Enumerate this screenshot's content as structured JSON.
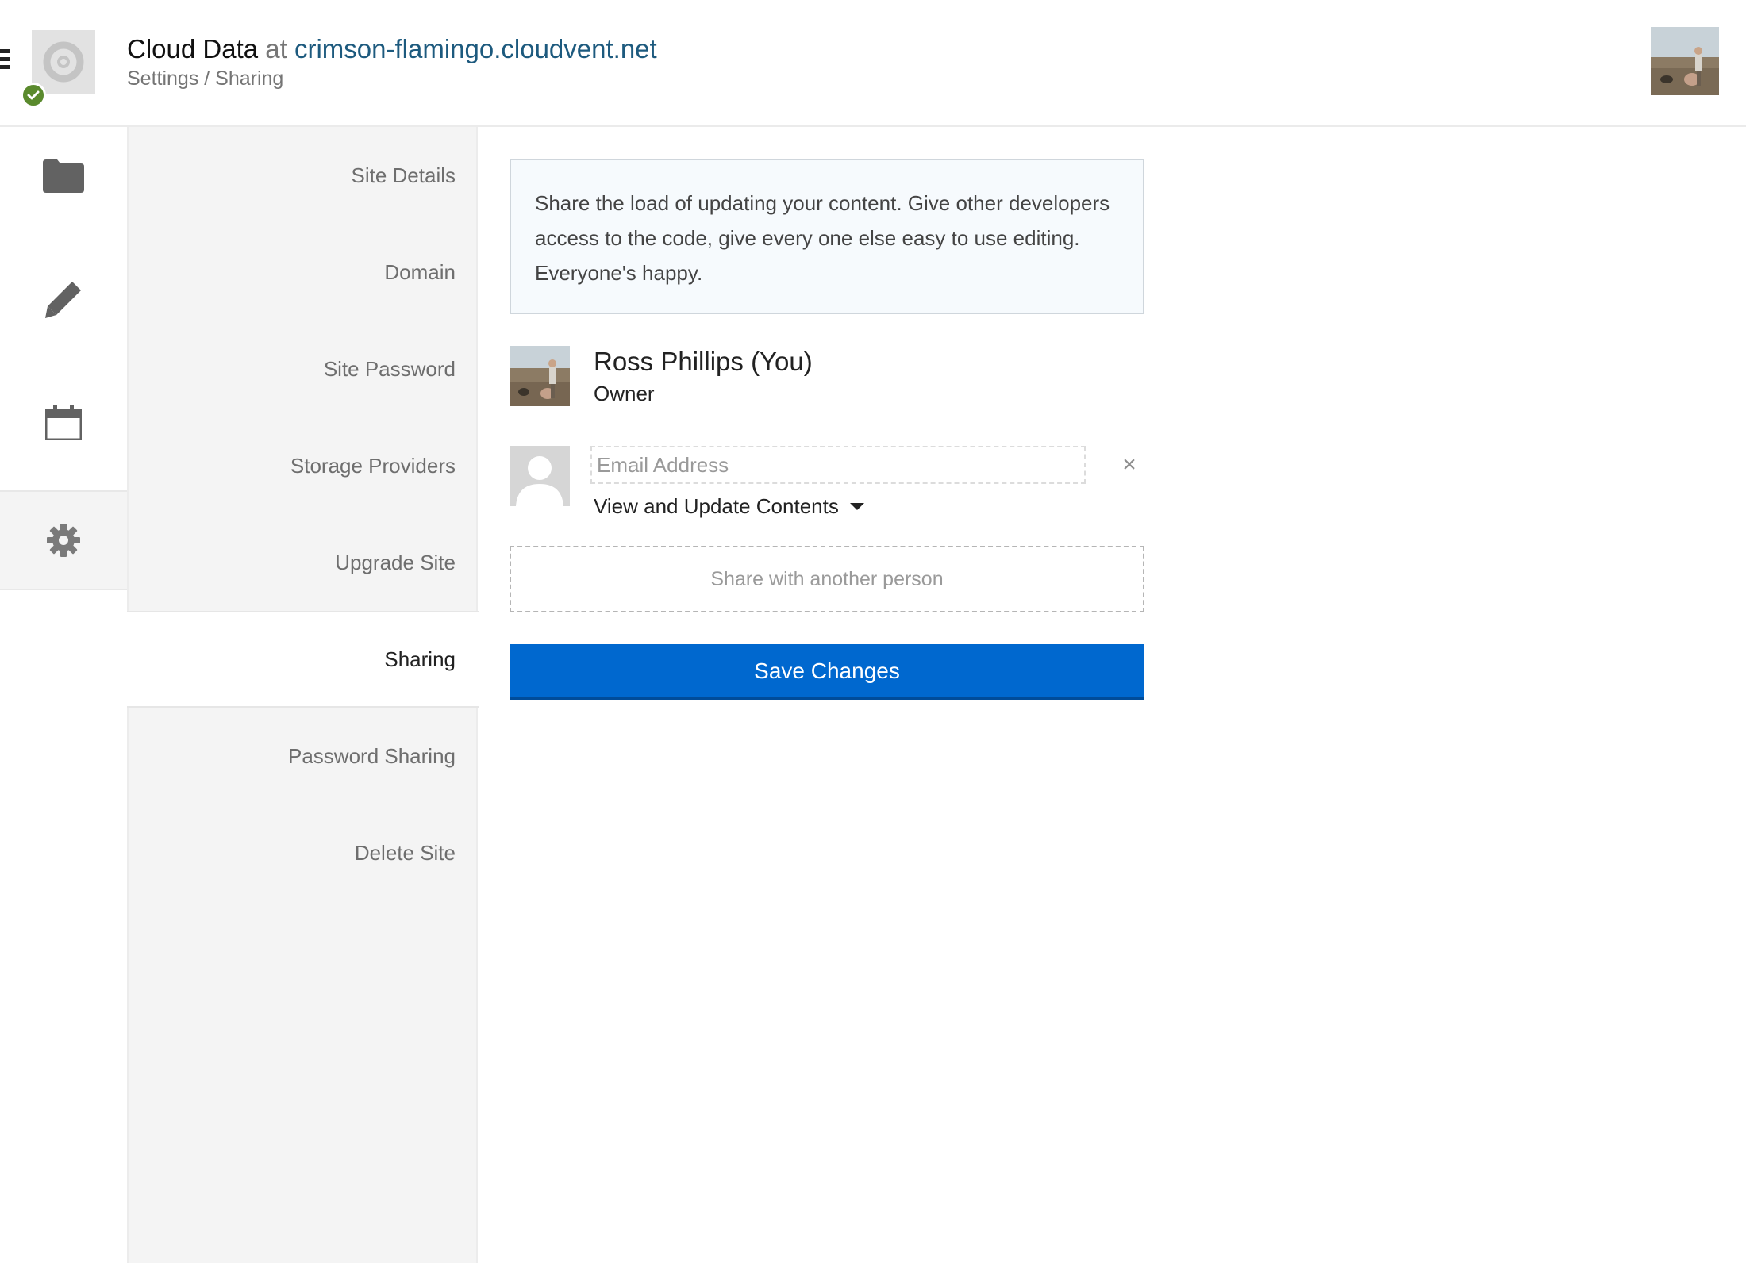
{
  "header": {
    "app_name": "Cloud Data",
    "at_word": "at",
    "site_domain": "crimson-flamingo.cloudvent.net",
    "breadcrumb": "Settings / Sharing"
  },
  "rail": {
    "items": [
      {
        "icon": "folder-icon"
      },
      {
        "icon": "pencil-icon"
      },
      {
        "icon": "calendar-icon"
      },
      {
        "icon": "gear-icon",
        "active": true
      }
    ]
  },
  "settings_nav": {
    "items": [
      {
        "label": "Site Details"
      },
      {
        "label": "Domain"
      },
      {
        "label": "Site Password"
      },
      {
        "label": "Storage Providers"
      },
      {
        "label": "Upgrade Site"
      },
      {
        "label": "Sharing",
        "active": true
      },
      {
        "label": "Password Sharing"
      },
      {
        "label": "Delete Site"
      }
    ]
  },
  "sharing": {
    "intro": "Share the load of updating your content. Give other developers access to the code, give every one else easy to use editing. Everyone's happy.",
    "owner": {
      "name": "Ross Phillips (You)",
      "role": "Owner"
    },
    "invite": {
      "email_placeholder": "Email Address",
      "email_value": "",
      "remove_label": "×",
      "permission_selected": "View and Update Contents"
    },
    "share_another_label": "Share with another person",
    "save_label": "Save Changes"
  },
  "colors": {
    "accent_blue": "#0068cf",
    "domain_link": "#1d5a7e",
    "status_green": "#5a8a2d",
    "nav_background": "#f4f4f4"
  }
}
